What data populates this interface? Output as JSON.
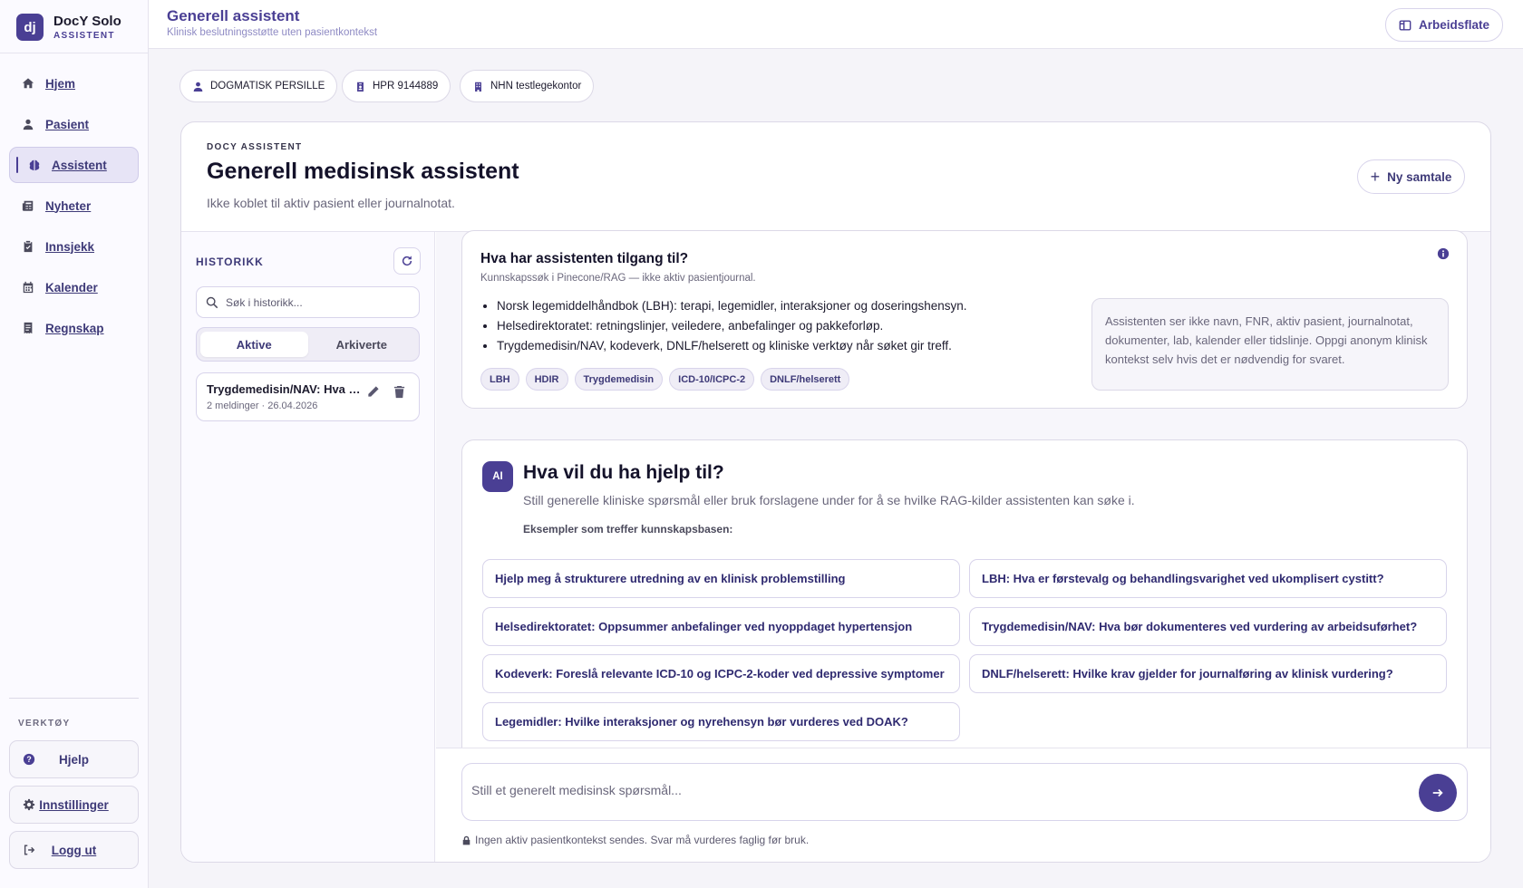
{
  "brand": {
    "logo": "dj",
    "name": "DocY Solo",
    "subtitle": "ASSISTENT"
  },
  "nav": [
    {
      "label": "Hjem",
      "icon": "home-icon"
    },
    {
      "label": "Pasient",
      "icon": "person-icon"
    },
    {
      "label": "Assistent",
      "icon": "brain-icon",
      "active": true
    },
    {
      "label": "Nyheter",
      "icon": "newspaper-icon"
    },
    {
      "label": "Innsjekk",
      "icon": "clipboard-check-icon"
    },
    {
      "label": "Kalender",
      "icon": "calendar-icon"
    },
    {
      "label": "Regnskap",
      "icon": "receipt-icon"
    }
  ],
  "tools": {
    "label": "VERKTØY",
    "help": "Hjelp",
    "settings": "Innstillinger",
    "logout": "Logg ut"
  },
  "header": {
    "title": "Generell assistent",
    "subtitle": "Klinisk beslutningsstøtte uten pasientkontekst",
    "workspace_button": "Arbeidsflate"
  },
  "chips": {
    "user": "DOGMATISK PERSILLE",
    "hpr": "HPR 9144889",
    "office": "NHN testlegekontor"
  },
  "card": {
    "kicker": "DOCY ASSISTENT",
    "title": "Generell medisinsk assistent",
    "subtitle": "Ikke koblet til aktiv pasient eller journalnotat.",
    "new_button": "Ny samtale"
  },
  "history": {
    "label": "HISTORIKK",
    "search_placeholder": "Søk i historikk...",
    "tabs": [
      "Aktive",
      "Arkiverte"
    ],
    "active_tab": "Aktive",
    "items": [
      {
        "title": "Trygdemedisin/NAV: Hva bør dokumenteres ved vurdering av arbeidsuførhet?",
        "meta": "2 meldinger · 26.04.2026"
      }
    ]
  },
  "info": {
    "title": "Hva har assistenten tilgang til?",
    "subtitle": "Kunnskapssøk i Pinecone/RAG — ikke aktiv pasientjournal.",
    "bullets": [
      "Norsk legemiddelhåndbok (LBH): terapi, legemidler, interaksjoner og doseringshensyn.",
      "Helsedirektoratet: retningslinjer, veiledere, anbefalinger og pakkeforløp.",
      "Trygdemedisin/NAV, kodeverk, DNLF/helserett og kliniske verktøy når søket gir treff."
    ],
    "tags": [
      "LBH",
      "HDIR",
      "Trygdemedisin",
      "ICD-10/ICPC-2",
      "DNLF/helserett"
    ],
    "notice": "Assistenten ser ikke navn, FNR, aktiv pasient, journalnotat, dokumenter, lab, kalender eller tidslinje. Oppgi anonym klinisk kontekst selv hvis det er nødvendig for svaret."
  },
  "help": {
    "badge": "AI",
    "title": "Hva vil du ha hjelp til?",
    "subtitle": "Still generelle kliniske spørsmål eller bruk forslagene under for å se hvilke RAG-kilder assistenten kan søke i.",
    "examples_label": "Eksempler som treffer kunnskapsbasen:",
    "suggestions": [
      "Hjelp meg å strukturere utredning av en klinisk problemstilling",
      "LBH: Hva er førstevalg og behandlingsvarighet ved ukomplisert cystitt?",
      "Helsedirektoratet: Oppsummer anbefalinger ved nyoppdaget hypertensjon",
      "Trygdemedisin/NAV: Hva bør dokumenteres ved vurdering av arbeidsuførhet?",
      "Kodeverk: Foreslå relevante ICD-10 og ICPC-2-koder ved depressive symptomer",
      "DNLF/helserett: Hvilke krav gjelder for journalføring av klinisk vurdering?",
      "Legemidler: Hvilke interaksjoner og nyrehensyn bør vurderes ved DOAK?"
    ]
  },
  "composer": {
    "placeholder": "Still et generelt medisinsk spørsmål...",
    "privacy": "Ingen aktiv pasientkontekst sendes. Svar må vurderes faglig før bruk."
  },
  "colors": {
    "accent": "#4a3f94",
    "background": "#f5f4f9",
    "border": "#dcd9e7"
  }
}
